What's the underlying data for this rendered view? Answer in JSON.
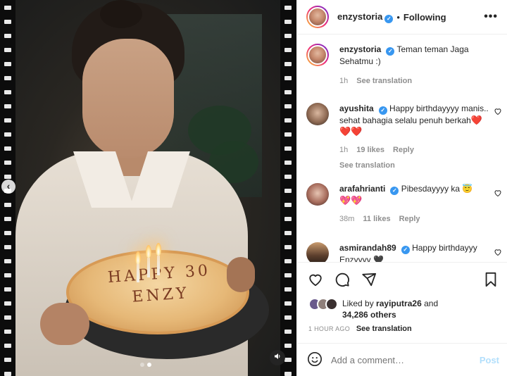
{
  "post": {
    "author": "enzystoria",
    "follow_status": "Following",
    "more_label": "•••"
  },
  "caption": {
    "username": "enzystoria",
    "text": "Teman teman Jaga Sehatmu :)",
    "time": "1h",
    "see_translation": "See translation"
  },
  "comments": [
    {
      "username": "ayushita",
      "text": "Happy birthdayyyy manis.. sehat bahagia selalu penuh berkah",
      "emoji": "❤️❤️❤️",
      "time": "1h",
      "likes": "19 likes",
      "reply": "Reply",
      "see_translation": "See translation"
    },
    {
      "username": "arafahrianti",
      "text": "Pibesdayyyy ka",
      "emoji": "😇",
      "emoji2": "💖💖",
      "time": "38m",
      "likes": "11 likes",
      "reply": "Reply"
    },
    {
      "username": "asmirandah89",
      "text": "Happy birthdayyy Enzyyyy",
      "emoji": "🖤"
    }
  ],
  "likes": {
    "prefix": "Liked by",
    "user": "rayiputra26",
    "middle": "and",
    "count": "34,286 others"
  },
  "timestamp": {
    "label": "1 HOUR AGO",
    "see_translation": "See translation"
  },
  "comment_box": {
    "placeholder": "Add a comment…",
    "post_label": "Post"
  },
  "media": {
    "cake_text": "HAPPY 30 ENZY",
    "carousel_dots": 2,
    "active_dot": 2
  },
  "icons": {
    "carousel_prev": "chevron-left-icon",
    "mute": "speaker-icon",
    "like": "heart-icon",
    "comment": "comment-icon",
    "share": "paper-plane-icon",
    "save": "bookmark-icon",
    "emoji": "smiley-icon",
    "verified": "verified-badge-icon"
  },
  "colors": {
    "verified": "#3897f0",
    "post_disabled": "#b2dffc",
    "meta_gray": "#8e8e8e",
    "heart_red": "#ed4956"
  }
}
